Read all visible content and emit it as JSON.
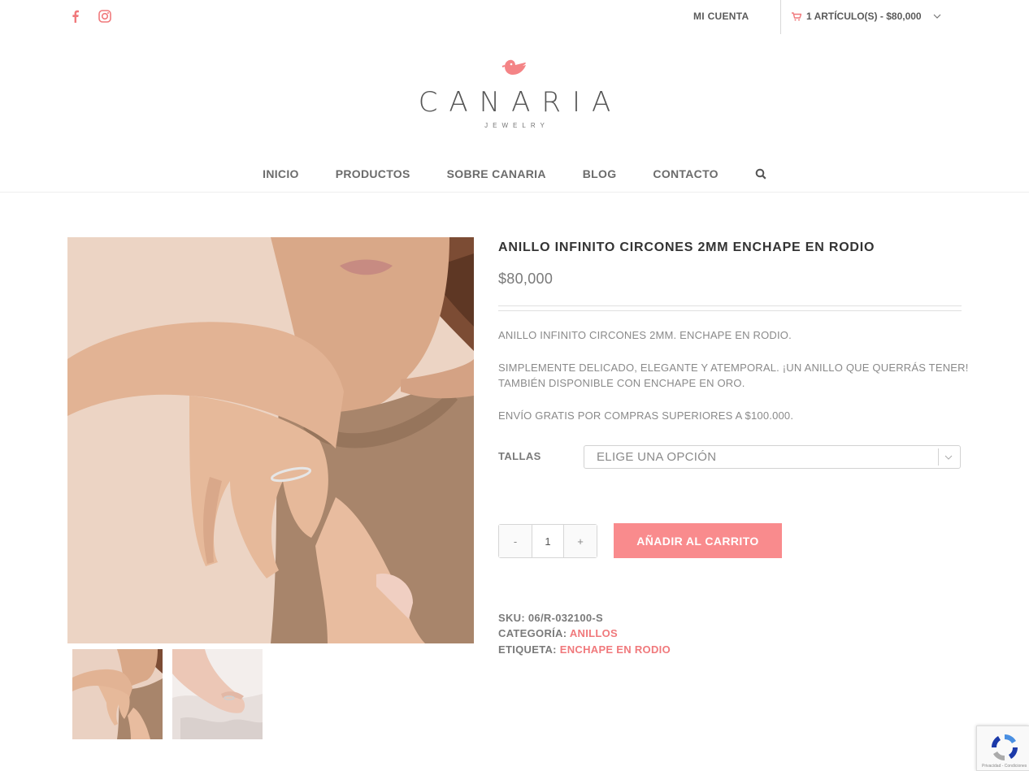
{
  "topbar": {
    "account_label": "MI CUENTA",
    "cart_label": "1 ARTÍCULO(S) - $80,000"
  },
  "logo": {
    "name": "CANARIA",
    "sub": "JEWELRY"
  },
  "nav": {
    "items": [
      "INICIO",
      "PRODUCTOS",
      "SOBRE CANARIA",
      "BLOG",
      "CONTACTO"
    ]
  },
  "product": {
    "title": "ANILLO INFINITO CIRCONES 2MM ENCHAPE EN RODIO",
    "price": "$80,000",
    "desc_1": "ANILLO INFINITO CIRCONES 2MM. ENCHAPE EN RODIO.",
    "desc_2": "SIMPLEMENTE DELICADO, ELEGANTE Y ATEMPORAL. ¡UN ANILLO QUE QUERRÁS TENER!",
    "desc_3": "TAMBIÉN DISPONIBLE CON ENCHAPE EN ORO.",
    "desc_4": "ENVÍO GRATIS POR COMPRAS SUPERIORES A $100.000.",
    "size_label": "TALLAS",
    "size_value": "ELIGE UNA OPCIÓN",
    "qty_minus": "-",
    "qty": "1",
    "qty_plus": "+",
    "add_to_cart": "AÑADIR AL CARRITO",
    "sku_label": "SKU:",
    "sku": "06/R-032100-S",
    "category_label": "CATEGORÍA:",
    "category": "ANILLOS",
    "tag_label": "ETIQUETA:",
    "tag": "ENCHAPE EN RODIO"
  },
  "recaptcha": {
    "text": "Privacidad - Condiciones"
  },
  "colors": {
    "accent": "#f98b8d",
    "link": "#f0797c",
    "text": "#747474"
  },
  "icons": [
    "facebook-icon",
    "instagram-icon",
    "cart-icon",
    "chevron-down-icon",
    "search-icon",
    "bird-logo-icon"
  ]
}
